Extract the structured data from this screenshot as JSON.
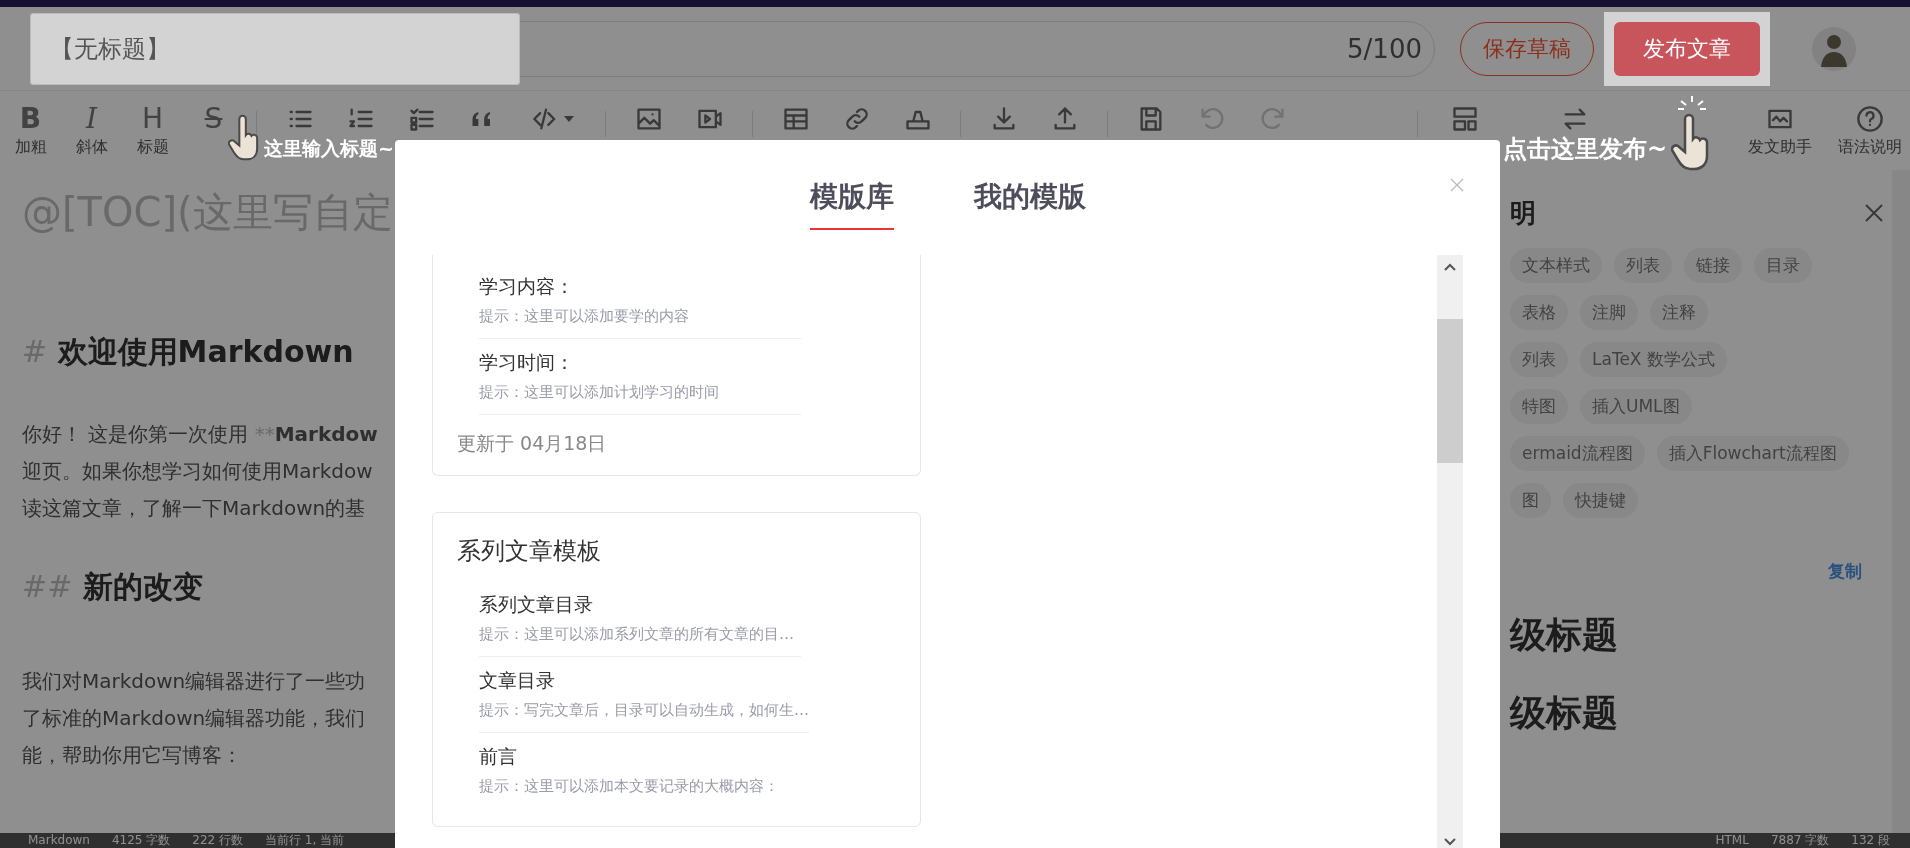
{
  "header": {
    "title_field": {
      "value": "【无标题】",
      "highlighted": true
    },
    "counter": "5/100",
    "buttons": [
      {
        "label": "保存草稿",
        "kind": "outline",
        "highlighted": false
      },
      {
        "label": "发布文章",
        "kind": "primary",
        "highlighted": true
      }
    ]
  },
  "toolbar": [
    {
      "kind": "bold",
      "glyph": "B",
      "label": "加粗"
    },
    {
      "kind": "italic",
      "glyph": "I",
      "label": "斜体"
    },
    {
      "kind": "heading",
      "glyph": "H",
      "label": "标题"
    },
    {
      "kind": "strike",
      "glyph": "S"
    },
    {
      "kind": "list",
      "sep_before": true
    },
    {
      "kind": "ordered-list"
    },
    {
      "kind": "task-list"
    },
    {
      "kind": "quote"
    },
    {
      "kind": "code"
    },
    {
      "kind": "image",
      "sep_before": true
    },
    {
      "kind": "video"
    },
    {
      "kind": "table",
      "sep_before": true
    },
    {
      "kind": "link"
    },
    {
      "kind": "stamp"
    },
    {
      "kind": "download",
      "sep_before": true
    },
    {
      "kind": "upload"
    },
    {
      "kind": "save",
      "sep_before": true
    },
    {
      "kind": "undo",
      "disabled": true
    },
    {
      "kind": "redo",
      "disabled": true
    },
    {
      "kind": "layout",
      "sep_before": true
    },
    {
      "kind": "swap"
    },
    {
      "kind": "blank"
    },
    {
      "kind": "chart",
      "label": "发文助手"
    },
    {
      "kind": "help",
      "label": "语法说明"
    }
  ],
  "coach_marks": [
    {
      "text": "这里输入标题~"
    },
    {
      "text": "点击这里发布~"
    }
  ],
  "editor": {
    "lines": [
      {
        "kind": "toc",
        "text": "@[TOC](这里写自定"
      },
      {
        "kind": "h1",
        "marker": "#",
        "text": "欢迎使用Markdown"
      },
      {
        "kind": "p",
        "text": "你好！ 这是你第一次使用 ",
        "marker": "**",
        "bold": "Markdow"
      },
      {
        "kind": "p",
        "text": "迎页。如果你想学习如何使用Markdow"
      },
      {
        "kind": "p",
        "text": "读这篇文章，了解一下Markdown的基"
      },
      {
        "kind": "h2",
        "marker": "##",
        "text": "新的改变"
      },
      {
        "kind": "p",
        "text": "我们对Markdown编辑器进行了一些功"
      },
      {
        "kind": "p",
        "text": "了标准的Markdown编辑器功能，我们"
      },
      {
        "kind": "p",
        "text": "能，帮助你用它写博客："
      }
    ]
  },
  "help_panel": {
    "title": "明",
    "chip_rows": [
      [
        "文本样式",
        "列表",
        "链接",
        "目录"
      ],
      [
        "表格",
        "注脚",
        "注释"
      ],
      [
        "列表",
        "LaTeX 数学公式"
      ],
      [
        "特图",
        "插入UML图"
      ],
      [
        "ermaid流程图",
        "插入Flowchart流程图"
      ],
      [
        "图",
        "快捷键"
      ]
    ],
    "copy_link": "复制",
    "headings": [
      "级标题",
      "级标题"
    ]
  },
  "status_bar": {
    "left": [
      "Markdown",
      "4125 字数",
      "222 行数",
      "当前行 1, 当前"
    ],
    "right": [
      "HTML",
      "7887 字数",
      "132 段"
    ]
  },
  "modal": {
    "tabs": [
      {
        "label": "模版库",
        "selected": true
      },
      {
        "label": "我的模版",
        "selected": false
      }
    ],
    "cards": [
      {
        "items": [
          {
            "name": "学习内容：",
            "hint": "提示：这里可以添加要学的内容"
          },
          {
            "name": "学习时间：",
            "hint": "提示：这里可以添加计划学习的时间"
          }
        ],
        "updated": "更新于 04月18日"
      },
      {
        "title": "系列文章模板",
        "items": [
          {
            "name": "系列文章目录",
            "hint": "提示：这里可以添加系列文章的所有文章的目…"
          },
          {
            "name": "文章目录",
            "hint": "提示：写完文章后，目录可以自动生成，如何生…"
          },
          {
            "name": "前言",
            "hint": "提示：这里可以添加本文要记录的大概内容："
          }
        ]
      }
    ]
  }
}
